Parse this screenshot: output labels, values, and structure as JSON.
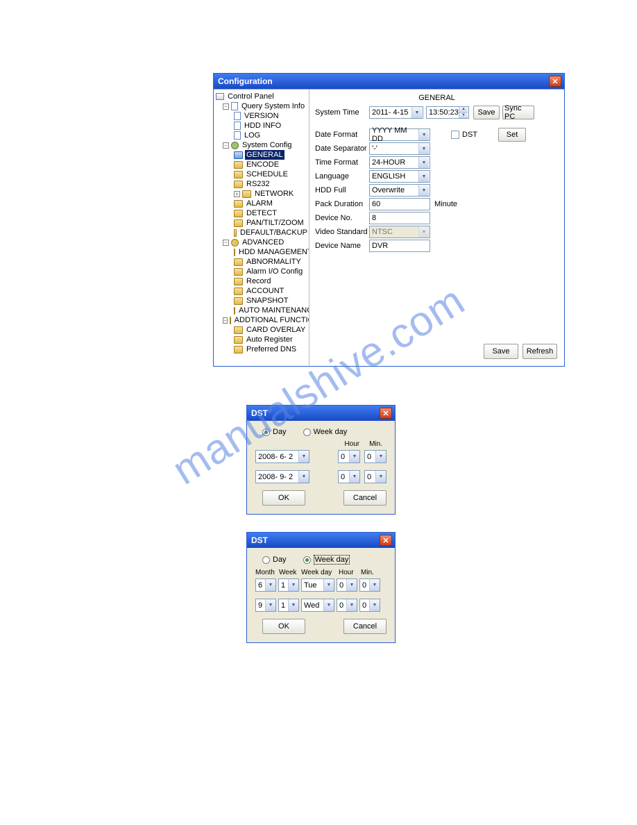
{
  "watermark": "manualshive.com",
  "config": {
    "title": "Configuration",
    "section": "GENERAL",
    "tree": {
      "root": "Control Panel",
      "qsi": "Query System Info",
      "version": "VERSION",
      "hddinfo": "HDD INFO",
      "log": "LOG",
      "sysconf": "System Config",
      "general": "GENERAL",
      "encode": "ENCODE",
      "schedule": "SCHEDULE",
      "rs232": "RS232",
      "network": "NETWORK",
      "alarm": "ALARM",
      "detect": "DETECT",
      "ptz": "PAN/TILT/ZOOM",
      "defbk": "DEFAULT/BACKUP",
      "advanced": "ADVANCED",
      "hddmgmt": "HDD MANAGEMENT",
      "abnorm": "ABNORMALITY",
      "alarmio": "Alarm I/O Config",
      "record": "Record",
      "account": "ACCOUNT",
      "snapshot": "SNAPSHOT",
      "automaint": "AUTO MAINTENANCE",
      "addfunc": "ADDTIONAL FUNCTION",
      "cardov": "CARD OVERLAY",
      "autoreg": "Auto Register",
      "prefdns": "Preferred DNS"
    },
    "labels": {
      "system_time": "System Time",
      "date_format": "Date Format",
      "date_sep": "Date Separator",
      "time_format": "Time Format",
      "language": "Language",
      "hdd_full": "HDD Full",
      "pack_dur": "Pack Duration",
      "device_no": "Device No.",
      "video_std": "Video Standard",
      "device_name": "Device Name",
      "minute": "Minute",
      "dst": "DST"
    },
    "values": {
      "date": "2011- 4-15",
      "time": "13:50:23",
      "date_format": "YYYY MM DD",
      "date_sep": "'-'",
      "time_format": "24-HOUR",
      "language": "ENGLISH",
      "hdd_full": "Overwrite",
      "pack_dur": "60",
      "device_no": "8",
      "video_std": "NTSC",
      "device_name": "DVR"
    },
    "buttons": {
      "save_top": "Save",
      "sync_pc": "Sync PC",
      "set": "Set",
      "save": "Save",
      "refresh": "Refresh"
    }
  },
  "dst1": {
    "title": "DST",
    "radio_day": "Day",
    "radio_week": "Week day",
    "hdr_hour": "Hour",
    "hdr_min": "Min.",
    "date1": "2008- 6- 2",
    "date2": "2008- 9- 2",
    "h1": "0",
    "m1": "0",
    "h2": "0",
    "m2": "0",
    "ok": "OK",
    "cancel": "Cancel"
  },
  "dst2": {
    "title": "DST",
    "radio_day": "Day",
    "radio_week": "Week day",
    "hdr_month": "Month",
    "hdr_week": "Week",
    "hdr_wkday": "Week day",
    "hdr_hour": "Hour",
    "hdr_min": "Min.",
    "r1_month": "6",
    "r1_week": "1",
    "r1_wkday": "Tue",
    "r1_hour": "0",
    "r1_min": "0",
    "r2_month": "9",
    "r2_week": "1",
    "r2_wkday": "Wed",
    "r2_hour": "0",
    "r2_min": "0",
    "ok": "OK",
    "cancel": "Cancel"
  }
}
